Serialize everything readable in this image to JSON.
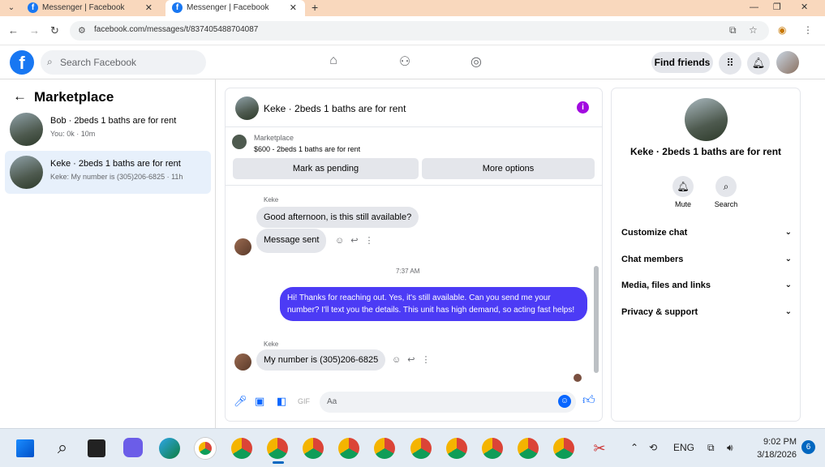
{
  "browser": {
    "tabs": [
      {
        "title": "Messenger | Facebook",
        "active": false
      },
      {
        "title": "Messenger | Facebook",
        "active": true
      }
    ],
    "url": "facebook.com/messages/t/837405488704087"
  },
  "header": {
    "search_placeholder": "Search Facebook",
    "find_friends": "Find friends"
  },
  "sidebar": {
    "title": "Marketplace",
    "conversations": [
      {
        "title": "Bob · 2beds 1 baths are for rent",
        "subtitle": "You: 0k · 10m"
      },
      {
        "title": "Keke · 2beds 1 baths are for rent",
        "subtitle": "Keke: My number is (305)206-6825 · 11h"
      }
    ]
  },
  "chat": {
    "title": "Keke · 2beds 1 baths are for rent",
    "listing": {
      "label": "Marketplace",
      "detail": "$600 - 2beds 1 baths are for rent",
      "mark_pending": "Mark as pending",
      "more_options": "More options"
    },
    "messages": {
      "sender1": "Keke",
      "m1": "Good afternoon, is this still available?",
      "m2": "Message sent",
      "time": "7:37 AM",
      "m3": "Hi! Thanks for reaching out. Yes, it's still available. Can you send me your number? I'll text you the details. This unit has high demand, so acting fast helps!",
      "sender2": "Keke",
      "m4": "My number is (305)206-6825"
    },
    "composer_placeholder": "Aa"
  },
  "details": {
    "name": "Keke · 2beds 1 baths are for rent",
    "mute": "Mute",
    "search": "Search",
    "sections": [
      "Customize chat",
      "Chat members",
      "Media, files and links",
      "Privacy & support"
    ]
  },
  "taskbar": {
    "lang": "ENG",
    "time": "9:02 PM",
    "date": "3/18/2026",
    "notifications": "6"
  }
}
